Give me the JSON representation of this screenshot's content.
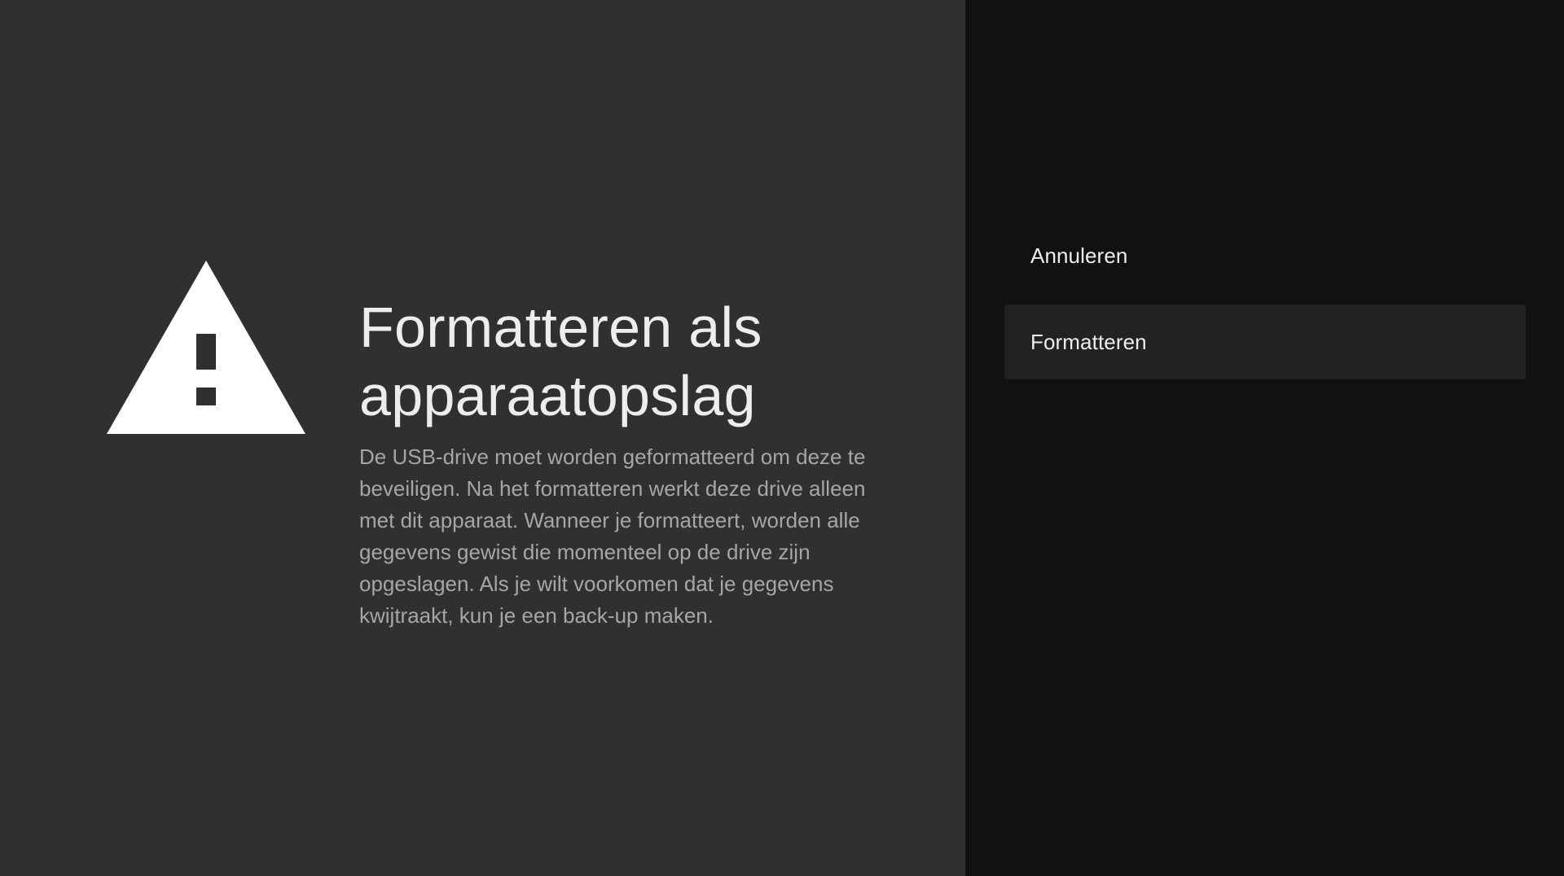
{
  "dialog": {
    "title": "Formatteren als apparaatopslag",
    "description": "De USB-drive moet worden geformatteerd om deze te beveiligen. Na het formatteren werkt deze drive alleen met dit apparaat. Wanneer je formatteert, worden alle gegevens gewist die momenteel op de drive zijn opgeslagen. Als je wilt voorkomen dat je gegevens kwijtraakt, kun je een back-up maken.",
    "icon": "warning-icon"
  },
  "actions": [
    {
      "label": "Annuleren",
      "focused": false
    },
    {
      "label": "Formatteren",
      "focused": true
    }
  ],
  "colors": {
    "left_background": "#303030",
    "right_background": "#111111",
    "focused_item": "#222222",
    "title_text": "#ededed",
    "description_text": "#a6a6a6"
  }
}
